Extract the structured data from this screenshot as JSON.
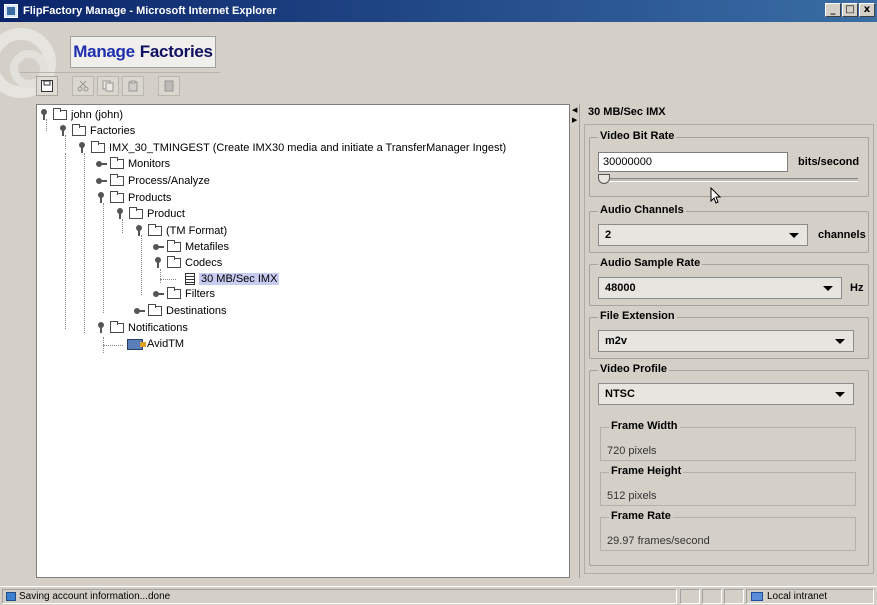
{
  "window": {
    "title": "FlipFactory Manage - Microsoft Internet Explorer",
    "buttons": [
      "_",
      "□",
      "x"
    ]
  },
  "header": {
    "title_word1": "Manage",
    "title_word2": "Factories",
    "title_color1": "#1e2fb0",
    "title_color2": "#101060"
  },
  "toolbar": {
    "buttons": [
      "save-icon",
      "cut-icon",
      "copy-icon",
      "paste-icon",
      "delete-icon"
    ]
  },
  "tree": {
    "nodes": [
      {
        "label": "john (john)",
        "icon": "folder",
        "expand": "open"
      },
      {
        "label": "Factories",
        "icon": "folder",
        "expand": "open"
      },
      {
        "label": "IMX_30_TMINGEST (Create IMX30 media and initiate a TransferManager  Ingest)",
        "icon": "folder",
        "expand": "open"
      },
      {
        "label": "Monitors",
        "icon": "folder",
        "expand": "closed"
      },
      {
        "label": "Process/Analyze",
        "icon": "folder",
        "expand": "closed"
      },
      {
        "label": "Products",
        "icon": "folder",
        "expand": "open"
      },
      {
        "label": "Product",
        "icon": "folder",
        "expand": "open"
      },
      {
        "label": "(TM Format)",
        "icon": "folder",
        "expand": "open"
      },
      {
        "label": "Metafiles",
        "icon": "folder",
        "expand": "closed"
      },
      {
        "label": "Codecs",
        "icon": "folder",
        "expand": "open"
      },
      {
        "label": "30 MB/Sec IMX",
        "icon": "document",
        "expand": "none",
        "selected": true
      },
      {
        "label": "Filters",
        "icon": "folder",
        "expand": "closed"
      },
      {
        "label": "Destinations",
        "icon": "folder",
        "expand": "closed"
      },
      {
        "label": "Notifications",
        "icon": "folder",
        "expand": "open"
      },
      {
        "label": "AvidTM",
        "icon": "destination",
        "expand": "none"
      }
    ]
  },
  "panel": {
    "title": "30 MB/Sec IMX",
    "video_bit_rate": {
      "label": "Video Bit Rate",
      "value": "30000000",
      "unit": "bits/second",
      "slider_fraction": 0.0
    },
    "audio_channels": {
      "label": "Audio Channels",
      "value": "2",
      "unit": "channels"
    },
    "audio_sample_rate": {
      "label": "Audio Sample Rate",
      "value": "48000",
      "unit": "Hz"
    },
    "file_extension": {
      "label": "File Extension",
      "value": "m2v"
    },
    "video_profile": {
      "label": "Video Profile",
      "value": "NTSC",
      "frame_width": {
        "label": "Frame Width",
        "value": "720 pixels"
      },
      "frame_height": {
        "label": "Frame Height",
        "value": "512 pixels"
      },
      "frame_rate": {
        "label": "Frame Rate",
        "value": "29.97 frames/second"
      }
    }
  },
  "status": {
    "text": "Saving account information...done",
    "zone": "Local intranet"
  }
}
